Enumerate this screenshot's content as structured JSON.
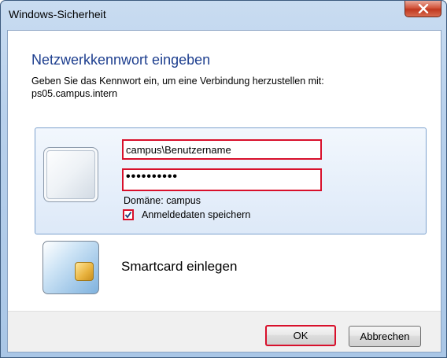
{
  "window": {
    "title": "Windows-Sicherheit"
  },
  "dialog": {
    "heading": "Netzwerkkennwort eingeben",
    "instruction_line1": "Geben Sie das Kennwort ein, um eine Verbindung herzustellen mit:",
    "instruction_line2": "ps05.campus.intern"
  },
  "credentials": {
    "username_value": "campus\\Benutzername",
    "password_value": "••••••••••",
    "domain_text": "Domäne: campus",
    "remember_label": "Anmeldedaten speichern",
    "remember_checked": true
  },
  "smartcard": {
    "label": "Smartcard einlegen"
  },
  "buttons": {
    "ok_label": "OK",
    "cancel_label": "Abbrechen"
  },
  "colors": {
    "highlight": "#d8102b",
    "heading": "#1e3f8f",
    "frame": "#b9d1ec"
  },
  "icons": [
    "close-icon",
    "user-tile-icon",
    "smartcard-icon",
    "checkmark-icon"
  ]
}
